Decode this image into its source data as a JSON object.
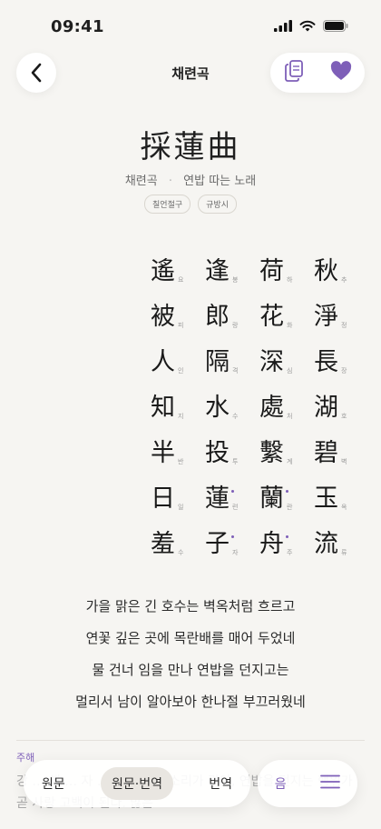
{
  "status": {
    "time": "09:41"
  },
  "header": {
    "title": "채련곡"
  },
  "poem": {
    "title": "採蓮曲",
    "subtitle_reading": "채련곡",
    "subtitle_meaning": "연밥 따는 노래",
    "tags": [
      "칠언절구",
      "규방시"
    ],
    "columns": [
      [
        {
          "h": "秋",
          "r": "추"
        },
        {
          "h": "淨",
          "r": "정"
        },
        {
          "h": "長",
          "r": "장"
        },
        {
          "h": "湖",
          "r": "호"
        },
        {
          "h": "碧",
          "r": "벽"
        },
        {
          "h": "玉",
          "r": "옥"
        },
        {
          "h": "流",
          "r": "류"
        }
      ],
      [
        {
          "h": "荷",
          "r": "하"
        },
        {
          "h": "花",
          "r": "화"
        },
        {
          "h": "深",
          "r": "심"
        },
        {
          "h": "處",
          "r": "처"
        },
        {
          "h": "繫",
          "r": "계"
        },
        {
          "h": "蘭",
          "r": "란",
          "mark": true
        },
        {
          "h": "舟",
          "r": "주",
          "mark": true
        }
      ],
      [
        {
          "h": "逢",
          "r": "봉"
        },
        {
          "h": "郎",
          "r": "랑"
        },
        {
          "h": "隔",
          "r": "격"
        },
        {
          "h": "水",
          "r": "수"
        },
        {
          "h": "投",
          "r": "투"
        },
        {
          "h": "蓮",
          "r": "련",
          "mark": true
        },
        {
          "h": "子",
          "r": "자",
          "mark": true
        }
      ],
      [
        {
          "h": "遙",
          "r": "요"
        },
        {
          "h": "被",
          "r": "피"
        },
        {
          "h": "人",
          "r": "인"
        },
        {
          "h": "知",
          "r": "지"
        },
        {
          "h": "半",
          "r": "반"
        },
        {
          "h": "日",
          "r": "일"
        },
        {
          "h": "羞",
          "r": "수"
        }
      ]
    ],
    "translation": [
      "가을 맑은 긴 호수는 벽옥처럼 흐르고",
      "연꽃 깊은 곳에 목란배를 매어 두었네",
      "물 건너 임을 만나 연밥을 던지고는",
      "멀리서 남이 알아보아 한나절 부끄러웠네"
    ]
  },
  "notes": {
    "label": "주해",
    "body": "강 … 채 … 자 … 연(蓮) … 소리가 같아, 연밥을 던지는 행위가 곧 사랑 고백이 된다. 많은"
  },
  "tabs": [
    {
      "label": "원문",
      "active": false
    },
    {
      "label": "원문·번역",
      "active": true
    },
    {
      "label": "번역",
      "active": false
    }
  ],
  "controls": {
    "sound_label": "음"
  },
  "colors": {
    "accent": "#7e5fb8",
    "background": "#f6f5f2"
  }
}
